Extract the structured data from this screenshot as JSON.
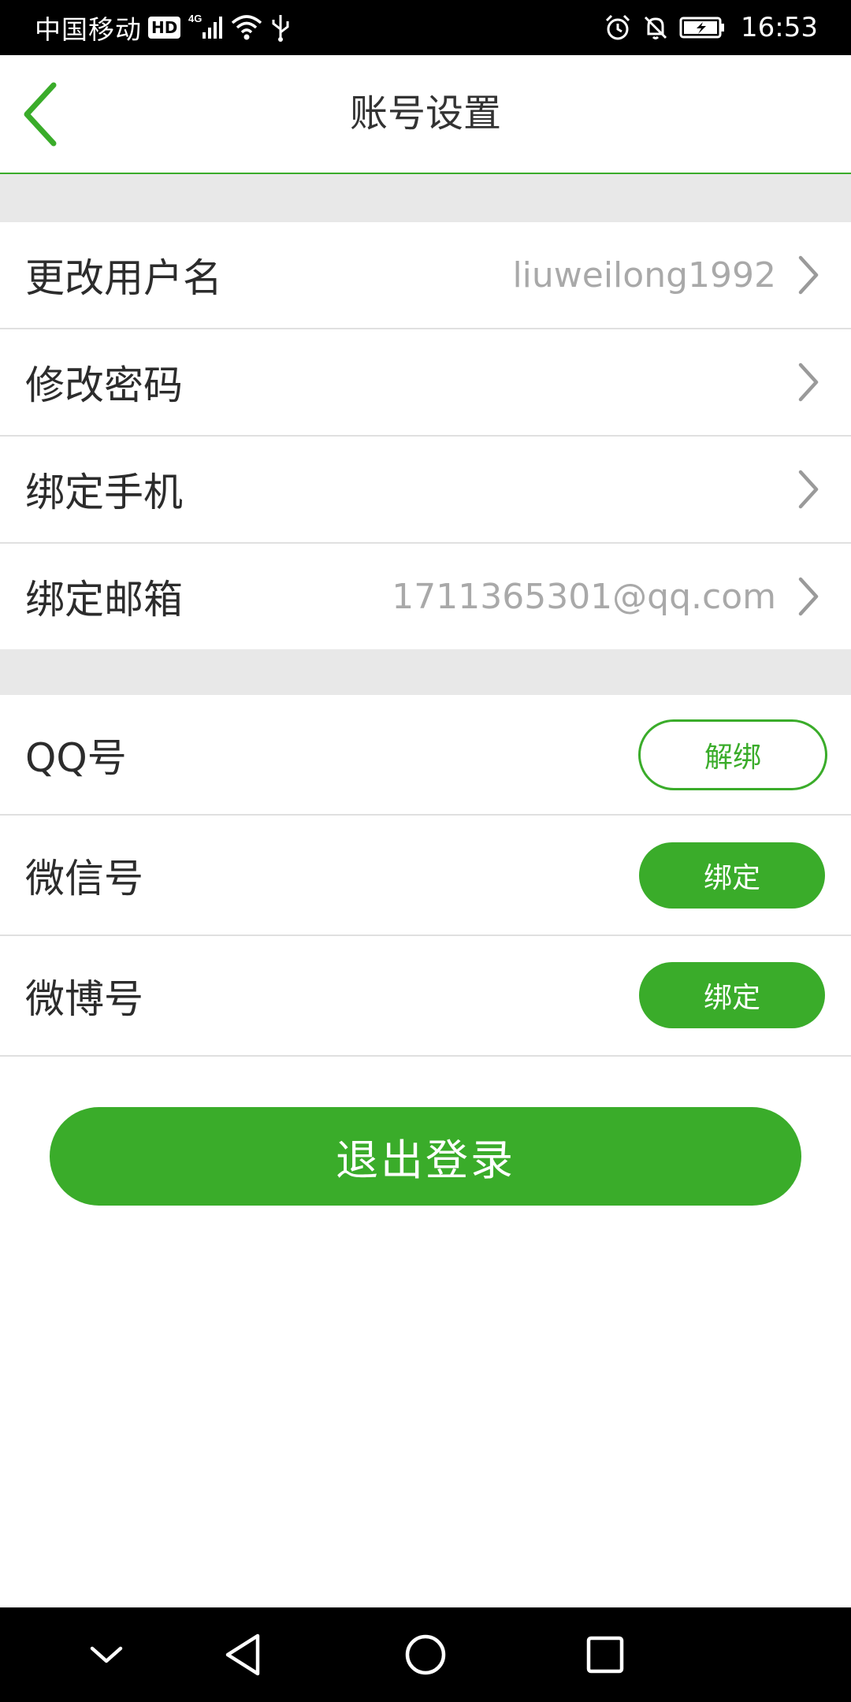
{
  "status_bar": {
    "carrier": "中国移动",
    "hd_badge": "HD",
    "network": "4G",
    "time": "16:53",
    "icons": [
      "hd-icon",
      "signal-icon",
      "wifi-icon",
      "usb-icon",
      "alarm-icon",
      "mute-icon",
      "battery-icon"
    ]
  },
  "header": {
    "title": "账号设置",
    "back_icon": "chevron-left-icon"
  },
  "account_rows": [
    {
      "label": "更改用户名",
      "value": "liuweilong1992"
    },
    {
      "label": "修改密码",
      "value": ""
    },
    {
      "label": "绑定手机",
      "value": ""
    },
    {
      "label": "绑定邮箱",
      "value": "1711365301@qq.com"
    }
  ],
  "social_rows": [
    {
      "label": "QQ号",
      "button": "解绑",
      "style": "outline"
    },
    {
      "label": "微信号",
      "button": "绑定",
      "style": "filled"
    },
    {
      "label": "微博号",
      "button": "绑定",
      "style": "filled"
    }
  ],
  "logout": {
    "label": "退出登录"
  },
  "nav_bar": {
    "icons": [
      "collapse-icon",
      "back-icon",
      "home-icon",
      "recents-icon"
    ]
  },
  "colors": {
    "accent": "#3aac2a",
    "status_bar": "#000000",
    "separator": "#e8e8e8",
    "label_text": "#2c2c2c",
    "value_text": "#a9a9a9"
  }
}
